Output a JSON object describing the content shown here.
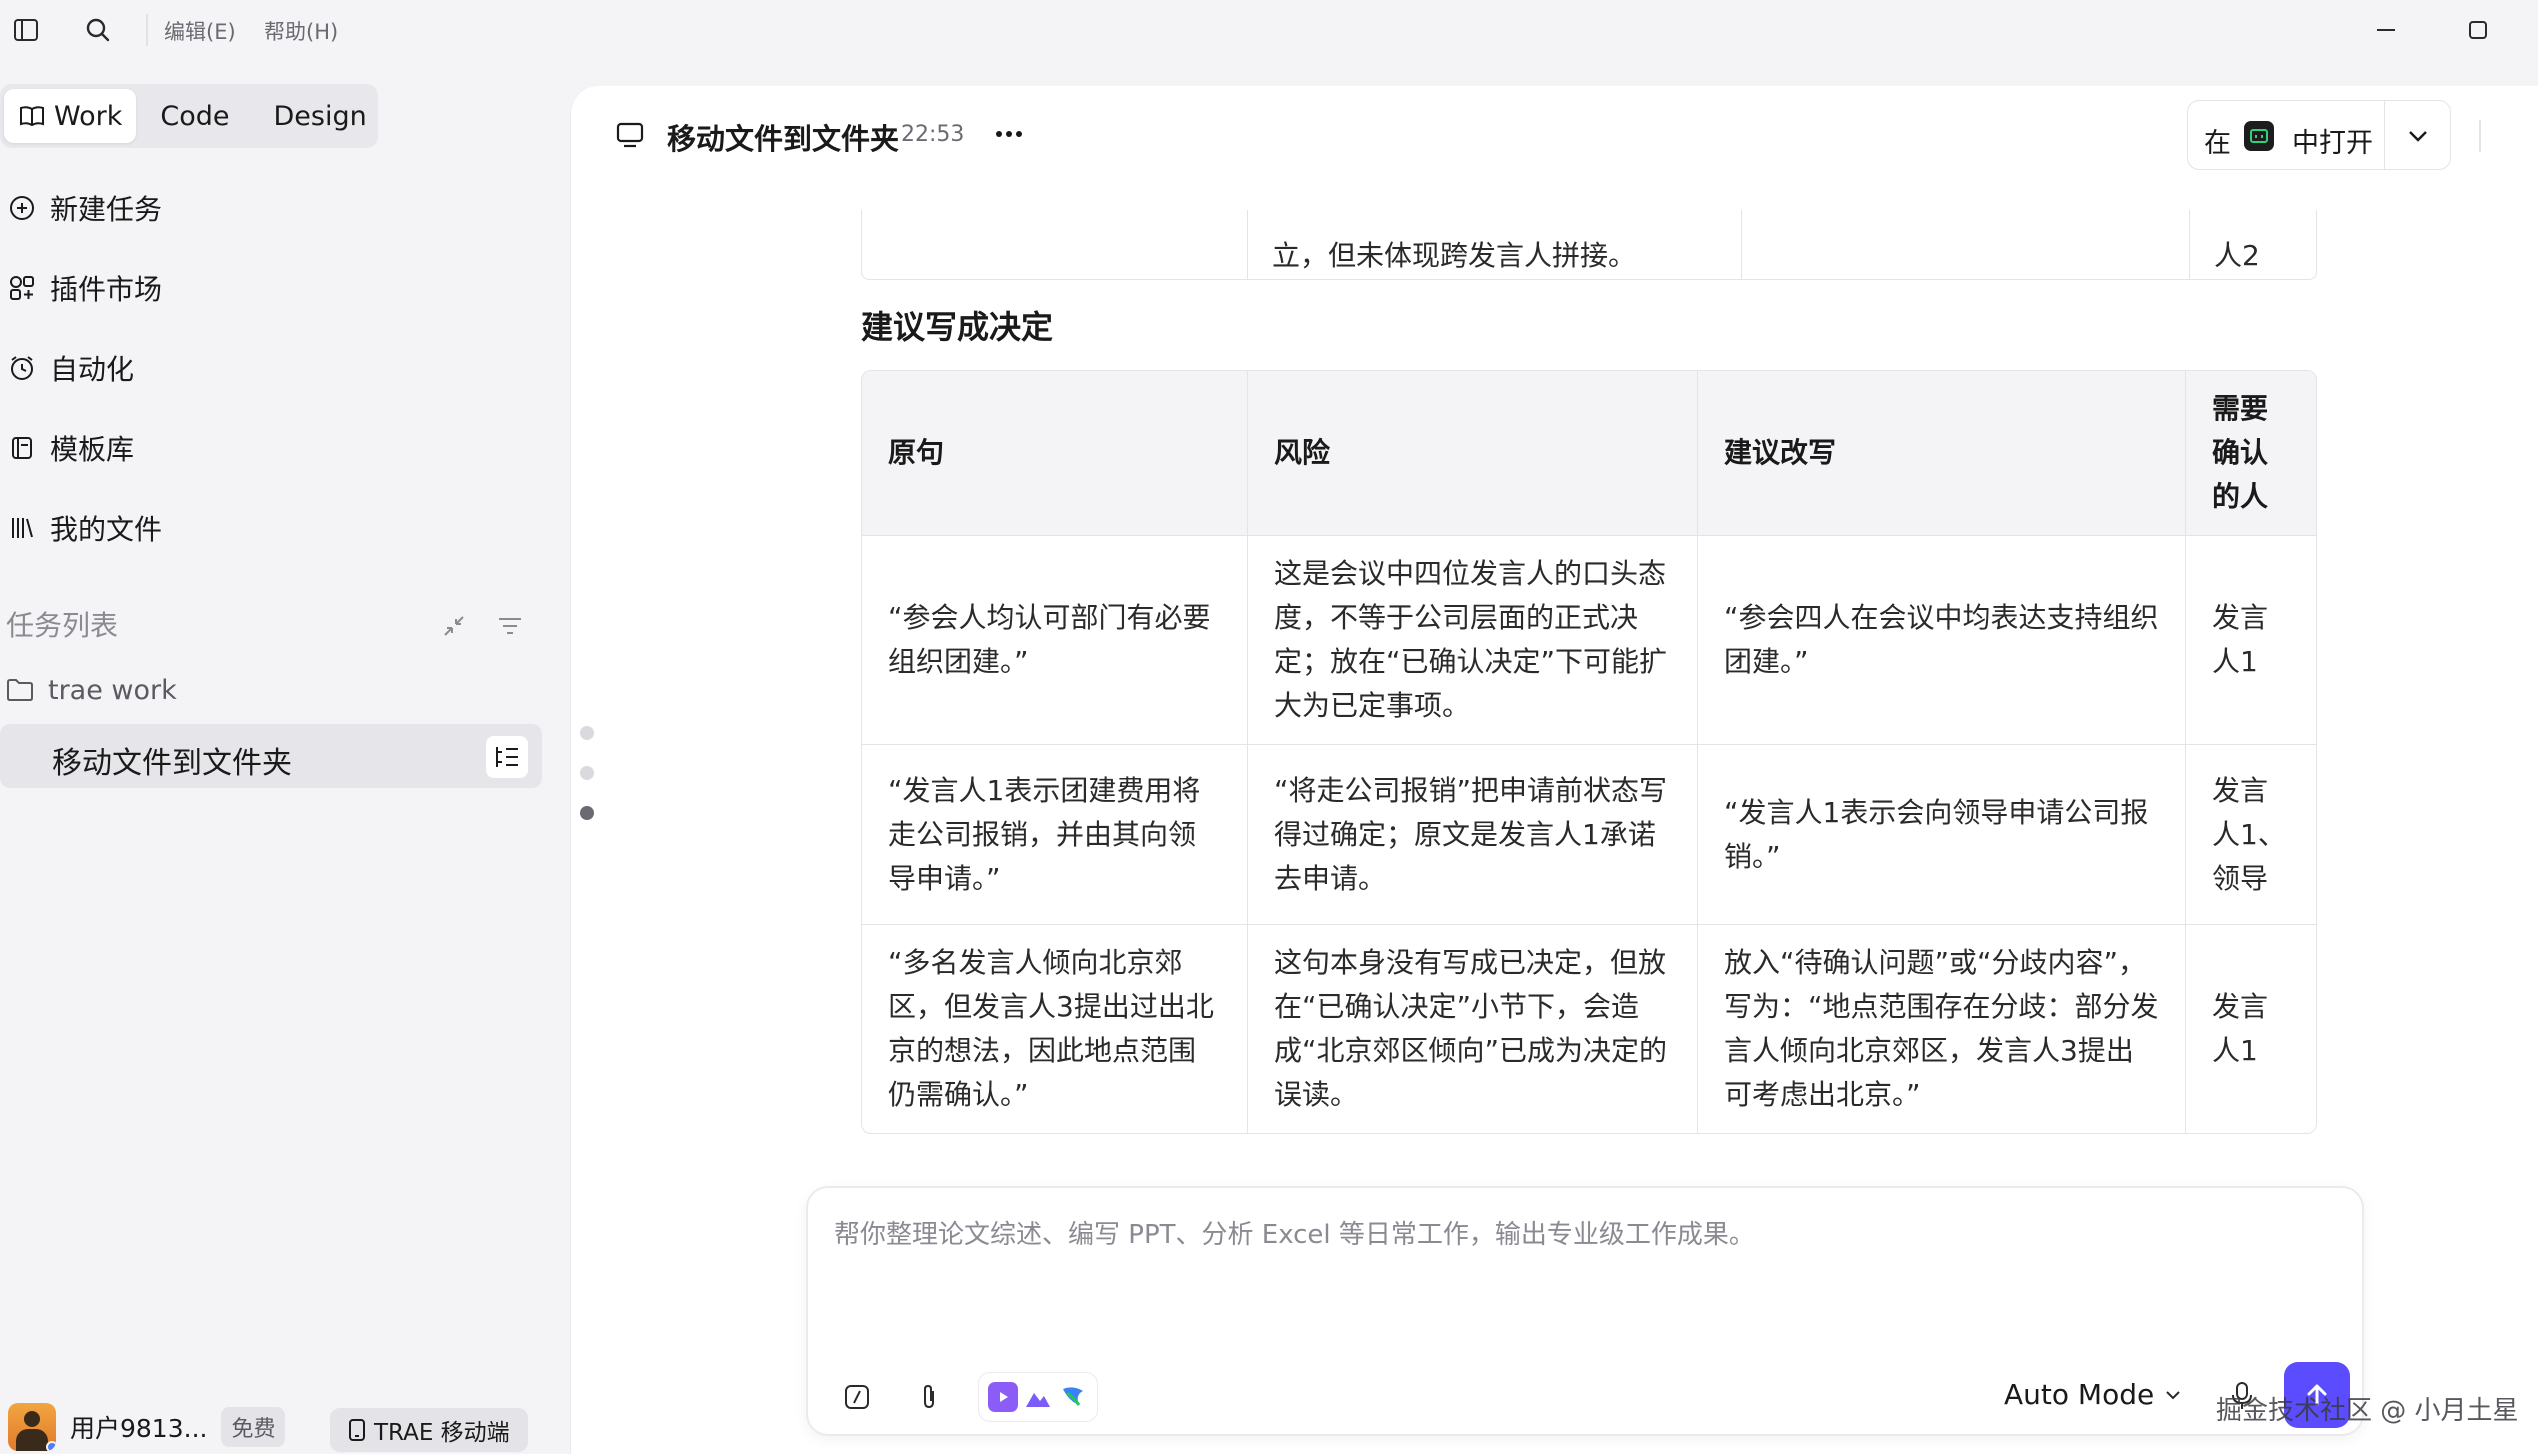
{
  "titlebar": {
    "menus": [
      "编辑(E)",
      "帮助(H)"
    ]
  },
  "sidebar": {
    "mode_tabs": [
      "Work",
      "Code",
      "Design"
    ],
    "active_mode": "Work",
    "nav": [
      {
        "label": "新建任务",
        "icon": "plus-circle-icon"
      },
      {
        "label": "插件市场",
        "icon": "plugin-grid-icon"
      },
      {
        "label": "自动化",
        "icon": "alarm-clock-icon"
      },
      {
        "label": "模板库",
        "icon": "template-icon"
      },
      {
        "label": "我的文件",
        "icon": "library-icon"
      }
    ],
    "task_section_title": "任务列表",
    "folder": "trae work",
    "active_task": "移动文件到文件夹",
    "user": {
      "name": "用户9813...",
      "plan": "免费"
    },
    "mobile_button": "TRAE 移动端"
  },
  "header": {
    "title": "移动文件到文件夹",
    "time": "22:53",
    "open_in_prefix": "在",
    "open_in_label": "中打开"
  },
  "content": {
    "previous_table_tail": [
      "",
      "立，但未体现跨发言人拼接。",
      "",
      "人2"
    ],
    "section_heading": "建议写成决定",
    "table": {
      "headers": [
        "原句",
        "风险",
        "建议改写",
        "需要确认的人"
      ],
      "rows": [
        [
          "“参会人均认可部门有必要组织团建。”",
          "这是会议中四位发言人的口头态度，不等于公司层面的正式决定；放在“已确认决定”下可能扩大为已定事项。",
          "“参会四人在会议中均表达支持组织团建。”",
          "发言人1"
        ],
        [
          "“发言人1表示团建费用将走公司报销，并由其向领导申请。”",
          "“将走公司报销”把申请前状态写得过确定；原文是发言人1承诺去申请。",
          "“发言人1表示会向领导申请公司报销。”",
          "发言人1、领导"
        ],
        [
          "“多名发言人倾向北京郊区，但发言人3提出过出北京的想法，因此地点范围仍需确认。”",
          "这句本身没有写成已决定，但放在“已确认决定”小节下，会造成“北京郊区倾向”已成为决定的误读。",
          "放入“待确认问题”或“分歧内容”，写为：“地点范围存在分歧：部分发言人倾向北京郊区，发言人3提出可考虑出北京。”",
          "发言人1"
        ]
      ]
    }
  },
  "composer": {
    "placeholder": "帮你整理论文综述、编写 PPT、分析 Excel 等日常工作，输出专业级工作成果。",
    "mode": "Auto Mode"
  },
  "watermark": "掘金技术社区 @ 小月土星",
  "colors": {
    "accent": "#5b4dff",
    "sidebar_bg": "#f4f4f6",
    "main_bg": "#ffffff"
  }
}
